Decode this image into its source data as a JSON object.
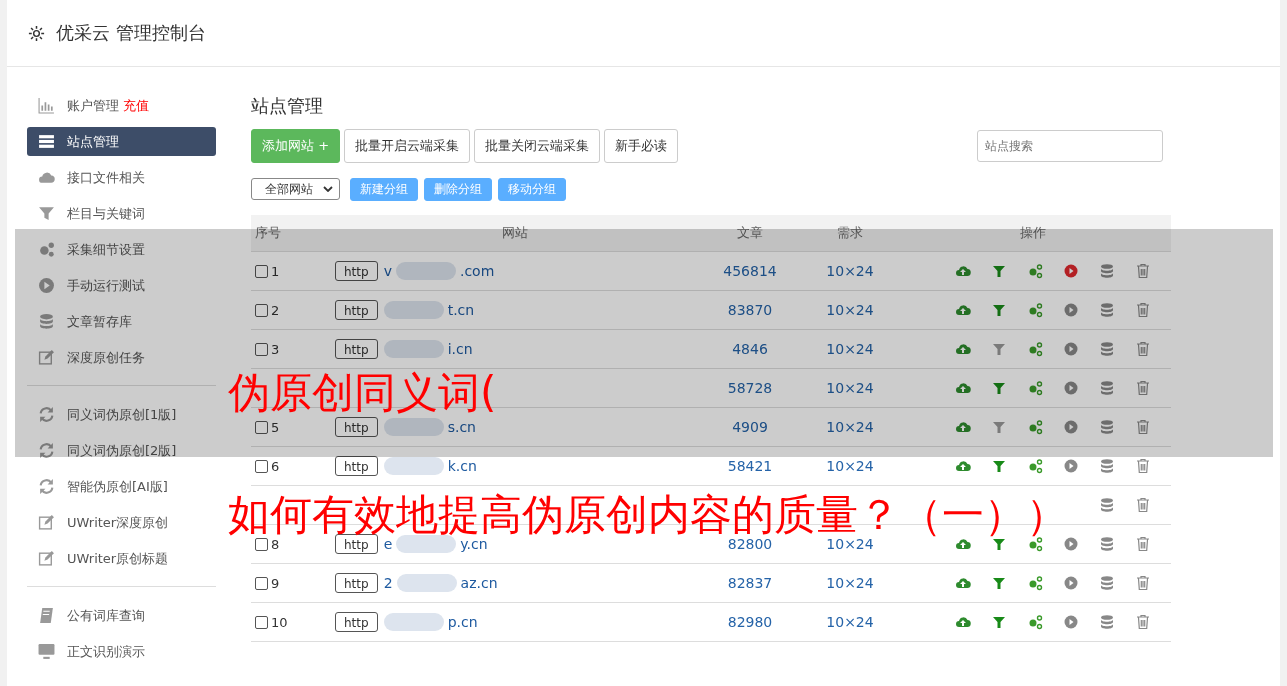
{
  "header": {
    "title": "优采云 管理控制台"
  },
  "sidebar": {
    "groups": [
      [
        {
          "label": "账户管理",
          "badge": "充值",
          "selected": false
        },
        {
          "label": "站点管理",
          "selected": true
        },
        {
          "label": "接口文件相关",
          "selected": false
        },
        {
          "label": "栏目与关键词",
          "selected": false
        },
        {
          "label": "采集细节设置",
          "selected": false
        },
        {
          "label": "手动运行测试",
          "selected": false
        },
        {
          "label": "文章暂存库",
          "selected": false
        },
        {
          "label": "深度原创任务",
          "selected": false
        }
      ],
      [
        {
          "label": "同义词伪原创[1版]",
          "selected": false
        },
        {
          "label": "同义词伪原创[2版]",
          "selected": false
        },
        {
          "label": "智能伪原创[AI版]",
          "selected": false
        },
        {
          "label": "UWriter深度原创",
          "selected": false
        },
        {
          "label": "UWriter原创标题",
          "selected": false
        }
      ],
      [
        {
          "label": "公有词库查询",
          "selected": false
        },
        {
          "label": "正文识别演示",
          "selected": false
        }
      ]
    ]
  },
  "page_title": "站点管理",
  "toolbar": {
    "primary": "添加网站 +",
    "buttons": [
      "批量开启云端采集",
      "批量关闭云端采集",
      "新手必读"
    ],
    "search": {
      "placeholder": "站点搜索"
    }
  },
  "group_bar": {
    "select": "全部网站",
    "buttons": [
      "新建分组",
      "删除分组",
      "移动分组"
    ]
  },
  "table": {
    "columns": [
      "序号",
      "网站",
      "文章",
      "需求",
      "操作"
    ],
    "rows": [
      {
        "checked": false,
        "index": "1",
        "scheme": "http",
        "site_prefix": "v",
        "site_suffix": ".com",
        "articles": "456814",
        "demand": "10×24",
        "filter_on": true,
        "running": true
      },
      {
        "checked": false,
        "index": "2",
        "scheme": "http",
        "site_suffix": "t.cn",
        "articles": "83870",
        "demand": "10×24",
        "filter_on": true,
        "running": false
      },
      {
        "checked": false,
        "index": "3",
        "scheme": "http",
        "site_suffix": "i.cn",
        "articles": "4846",
        "demand": "10×24",
        "filter_on": false,
        "running": false
      },
      {
        "articles": "58728",
        "demand": "10×24",
        "filter_on": true,
        "running": false
      },
      {
        "checked": false,
        "index": "5",
        "scheme": "http",
        "site_suffix": "s.cn",
        "articles": "4909",
        "demand": "10×24",
        "filter_on": false,
        "running": false
      },
      {
        "checked": false,
        "index": "6",
        "scheme": "http",
        "site_suffix": "k.cn",
        "articles": "58421",
        "demand": "10×24",
        "filter_on": true,
        "running": false
      },
      {
        "covered": true
      },
      {
        "checked": false,
        "index": "8",
        "scheme": "http",
        "site_prefix": "e",
        "site_suffix": "y.cn",
        "articles": "82800",
        "demand": "10×24",
        "filter_on": true,
        "running": false
      },
      {
        "checked": false,
        "index": "9",
        "scheme": "http",
        "site_prefix": "2",
        "site_suffix": "az.cn",
        "articles": "82837",
        "demand": "10×24",
        "filter_on": true,
        "running": false
      },
      {
        "checked": false,
        "index": "10",
        "scheme": "http",
        "site_suffix": "p.cn",
        "articles": "82980",
        "demand": "10×24",
        "filter_on": true,
        "running": false
      }
    ]
  },
  "overlay": {
    "lines": [
      "伪原创同义词(",
      "如何有效地提高伪原创内容的质量？（一））"
    ]
  }
}
